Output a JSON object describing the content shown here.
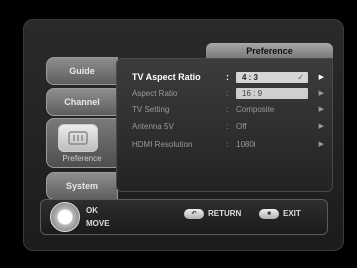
{
  "header": {
    "title": "Preference"
  },
  "sidebar": {
    "items": [
      {
        "label": "Guide"
      },
      {
        "label": "Channel"
      },
      {
        "label": "Preference"
      },
      {
        "label": "System"
      }
    ]
  },
  "menu": {
    "rows": [
      {
        "label": "TV Aspect Ratio",
        "colon": ":",
        "value": "4 : 3"
      },
      {
        "label": "Aspect Ratio",
        "colon": ":",
        "value": "16 : 9"
      },
      {
        "label": "TV Setting",
        "colon": ":",
        "value": "Composite"
      },
      {
        "label": "Antenna 5V",
        "colon": ":",
        "value": "Off"
      },
      {
        "label": "HDMI Resolution",
        "colon": ":",
        "value": "1080i"
      }
    ]
  },
  "footer": {
    "ok_label": "OK",
    "move_label": "MOVE",
    "return_label": "RETURN",
    "exit_label": "EXIT"
  },
  "icons": {
    "check": "check-icon",
    "arrow": "arrow-right-icon",
    "pref": "preference-icon",
    "navpad": "nav-pad-icon"
  }
}
